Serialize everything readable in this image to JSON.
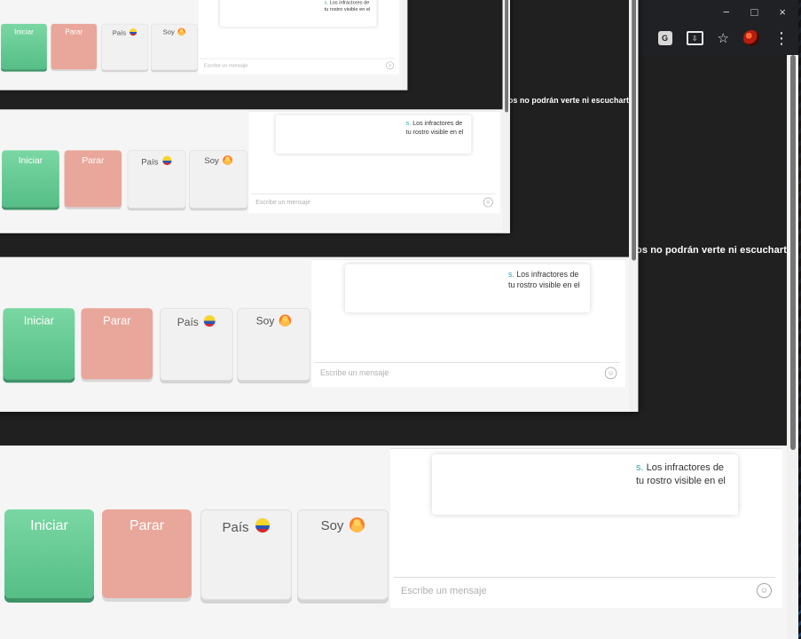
{
  "toolbar": {
    "translate_icon": "translate-icon",
    "install_icon": "install-app-icon",
    "bookmark_icon": "star-icon",
    "extension_icon": "extension-icon",
    "menu_icon": "kebab-menu-icon",
    "minimize_symbol": "−",
    "restore_symbol": "□",
    "close_symbol": "×",
    "bookmark_symbol": "☆",
    "menu_symbol": "⋮"
  },
  "video": {
    "text": "os no podrán verte ni escucharte."
  },
  "chat": {
    "notice_link": "s.",
    "notice_line_1": " Los infractores de",
    "notice_line_2": "tu rostro visible en el",
    "input_placeholder": "Escribe un mensaje",
    "emoji_icon": "smile-icon",
    "emoji_symbol": "☺"
  },
  "controls": {
    "start_label": "Iniciar",
    "stop_label": "Parar",
    "country_label": "País",
    "gender_label": "Soy",
    "country_flag": "colombia-flag-icon",
    "gender_icon": "person-icon"
  },
  "colors": {
    "start": "#58c48c",
    "stop": "#e9a79b",
    "browser": "#202124",
    "accent_link": "#2aa7a2"
  }
}
